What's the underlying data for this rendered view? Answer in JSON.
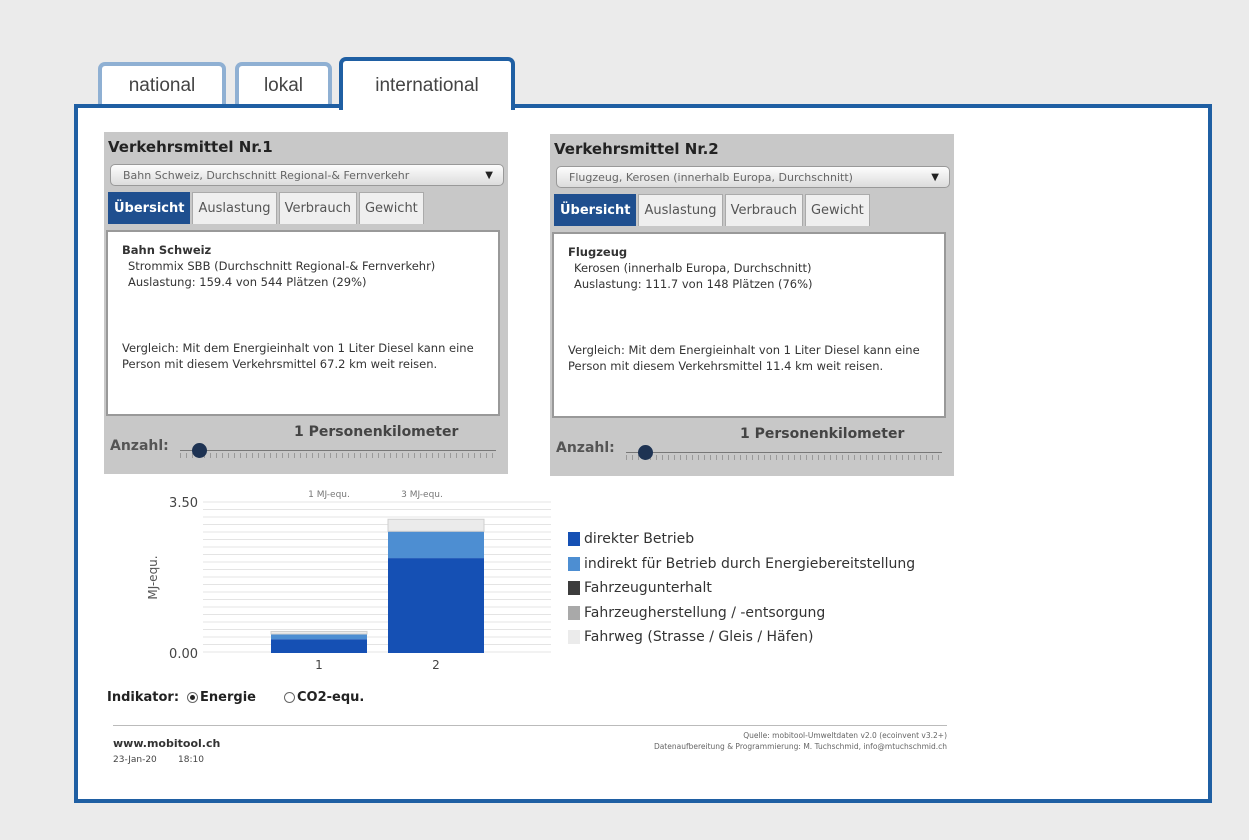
{
  "main_tabs": [
    {
      "label": "national",
      "active": false
    },
    {
      "label": "lokal",
      "active": false
    },
    {
      "label": "international",
      "active": true
    }
  ],
  "vm1": {
    "title": "Verkehrsmittel Nr.1",
    "select_value": "Bahn Schweiz, Durchschnitt Regional-& Fernverkehr",
    "tabs": [
      "Übersicht",
      "Auslastung",
      "Verbrauch",
      "Gewicht"
    ],
    "active_tab": "Übersicht",
    "info_title": "Bahn Schweiz",
    "info_line1": "Strommix SBB (Durchschnitt Regional-& Fernverkehr)",
    "info_line2": "Auslastung: 159.4 von 544 Plätzen (29%)",
    "info_compare": "Vergleich: Mit dem Energieinhalt von 1 Liter Diesel kann eine Person mit diesem Verkehrsmittel 67.2 km weit reisen.",
    "anzahl_label": "Anzahl:",
    "slider_value": "1 Personenkilometer",
    "slider_fraction": 0.06
  },
  "vm2": {
    "title": "Verkehrsmittel Nr.2",
    "select_value": "Flugzeug, Kerosen (innerhalb Europa, Durchschnitt)",
    "tabs": [
      "Übersicht",
      "Auslastung",
      "Verbrauch",
      "Gewicht"
    ],
    "active_tab": "Übersicht",
    "info_title": "Flugzeug",
    "info_line1": "Kerosen (innerhalb Europa, Durchschnitt)",
    "info_line2": "Auslastung: 111.7 von 148 Plätzen (76%)",
    "info_compare": "Vergleich: Mit dem Energieinhalt von 1 Liter Diesel kann eine Person mit diesem Verkehrsmittel 11.4 km weit reisen.",
    "anzahl_label": "Anzahl:",
    "slider_value": "1 Personenkilometer",
    "slider_fraction": 0.06
  },
  "chart_data": {
    "type": "bar",
    "stacked": true,
    "categories": [
      "1",
      "2"
    ],
    "ylabel": "MJ-equ.",
    "ylim": [
      0,
      3.5
    ],
    "ytick_labels": [
      "3.50",
      "0.00"
    ],
    "top_labels": [
      "1 MJ-equ.",
      "3 MJ-equ."
    ],
    "series": [
      {
        "name": "direkter Betrieb",
        "color": "#1550b4",
        "values": [
          0.32,
          2.2
        ]
      },
      {
        "name": "indirekt für Betrieb durch Energiebereitstellung",
        "color": "#4d8ed2",
        "values": [
          0.12,
          0.62
        ]
      },
      {
        "name": "Fahrzeugunterhalt",
        "color": "#3c3c3c",
        "values": [
          0.0,
          0.0
        ]
      },
      {
        "name": "Fahrzeugherstellung / -entsorgung",
        "color": "#a9a9a9",
        "values": [
          0.0,
          0.0
        ]
      },
      {
        "name": "Fahrweg  (Strasse / Gleis / Häfen)",
        "color": "#ebebeb",
        "values": [
          0.06,
          0.28
        ]
      }
    ],
    "grid": true
  },
  "indikator": {
    "label": "Indikator:",
    "options": [
      {
        "label": "Energie",
        "checked": true
      },
      {
        "label": "CO2-equ.",
        "checked": false
      }
    ]
  },
  "footer": {
    "site": "www.mobitool.ch",
    "date": "23-Jan-20",
    "time": "18:10",
    "source": "Quelle: mobitool-Umweltdaten v2.0 (ecoinvent v3.2+)",
    "credits": "Datenaufbereitung & Programmierung: M. Tuchschmid, info@mtuchschmid.ch"
  }
}
